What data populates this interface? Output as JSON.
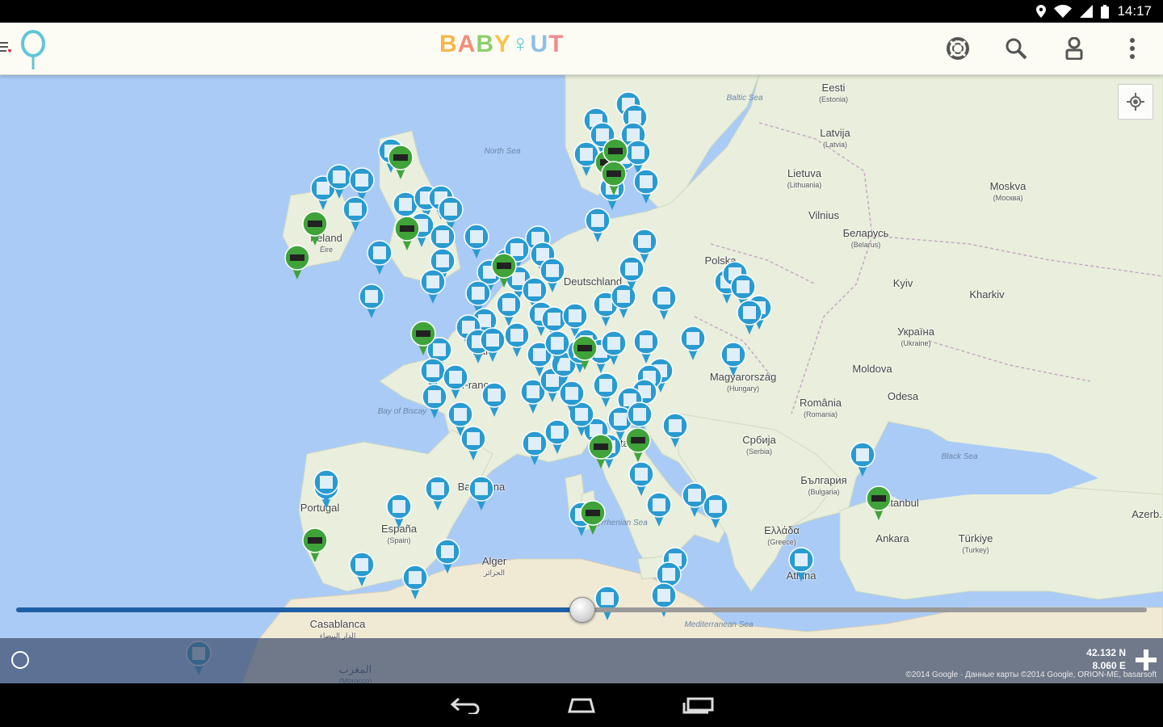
{
  "status_bar": {
    "time": "14:17"
  },
  "app": {
    "brand": [
      "B",
      "A",
      "B",
      "Y",
      "♀",
      "U",
      "T"
    ],
    "brand_colors": [
      "#f7b64b",
      "#f38d7a",
      "#8ccf6b",
      "#f6c54c",
      "#5fc6d6",
      "#8dbfe7",
      "#f08c8c"
    ],
    "actions": [
      "lifebuoy-icon",
      "search-icon",
      "user-icon",
      "overflow-menu-icon"
    ]
  },
  "map": {
    "country_labels": [
      {
        "name": "Eesti",
        "sub": "(Estonia)"
      },
      {
        "name": "Latvija",
        "sub": "(Latvia)"
      },
      {
        "name": "Lietuva",
        "sub": "(Lithuania)"
      },
      {
        "name": "Беларусь",
        "sub": "(Belarus)"
      },
      {
        "name": "Україна",
        "sub": "(Ukraine)"
      },
      {
        "name": "Moldova",
        "sub": ""
      },
      {
        "name": "România",
        "sub": "(Romania)"
      },
      {
        "name": "Magyarország",
        "sub": "(Hungary)"
      },
      {
        "name": "България",
        "sub": "(Bulgaria)"
      },
      {
        "name": "Србија",
        "sub": "(Serbia)"
      },
      {
        "name": "Türkiye",
        "sub": "(Turkey)"
      },
      {
        "name": "España",
        "sub": "(Spain)"
      },
      {
        "name": "Portugal",
        "sub": ""
      },
      {
        "name": "Ireland",
        "sub": "Éire"
      },
      {
        "name": "Deutschland",
        "sub": ""
      },
      {
        "name": "France",
        "sub": ""
      },
      {
        "name": "Italia",
        "sub": ""
      },
      {
        "name": "Ελλάδα",
        "sub": "(Greece)"
      },
      {
        "name": "Polska",
        "sub": ""
      },
      {
        "name": "Azerb.",
        "sub": ""
      },
      {
        "name": "Ankara",
        "sub": ""
      },
      {
        "name": "İstanbul",
        "sub": ""
      },
      {
        "name": "Athina",
        "sub": ""
      },
      {
        "name": "Alger",
        "sub": "الجزائر"
      },
      {
        "name": "Casablanca",
        "sub": "الدار البيضاء"
      },
      {
        "name": "المغرب",
        "sub": "(Morocco)"
      },
      {
        "name": "Moskva",
        "sub": "(Москва)"
      },
      {
        "name": "Kyiv",
        "sub": ""
      },
      {
        "name": "Kharkiv",
        "sub": ""
      },
      {
        "name": "Odesa",
        "sub": ""
      },
      {
        "name": "Vilnius",
        "sub": ""
      },
      {
        "name": "Paris",
        "sub": ""
      },
      {
        "name": "Barcelona",
        "sub": ""
      }
    ],
    "sea_labels": [
      "North Sea",
      "Baltic Sea",
      "Bay of Biscay",
      "Black Sea",
      "Tyrrhenian Sea",
      "Mediterranean Sea"
    ],
    "slider_fraction": 0.5,
    "coordinates": {
      "lat": "42.132 N",
      "lon": "8.060 E"
    },
    "copyright": "©2014 Google · Данные карты ©2014 Google, ORION-ME, basarsoft"
  },
  "colors": {
    "sea": "#aacbf6",
    "land": "#e9efdc",
    "pin_blue": "#2a9bd1",
    "pin_green": "#3fa33a",
    "slider_fill": "#1f5fa6"
  }
}
